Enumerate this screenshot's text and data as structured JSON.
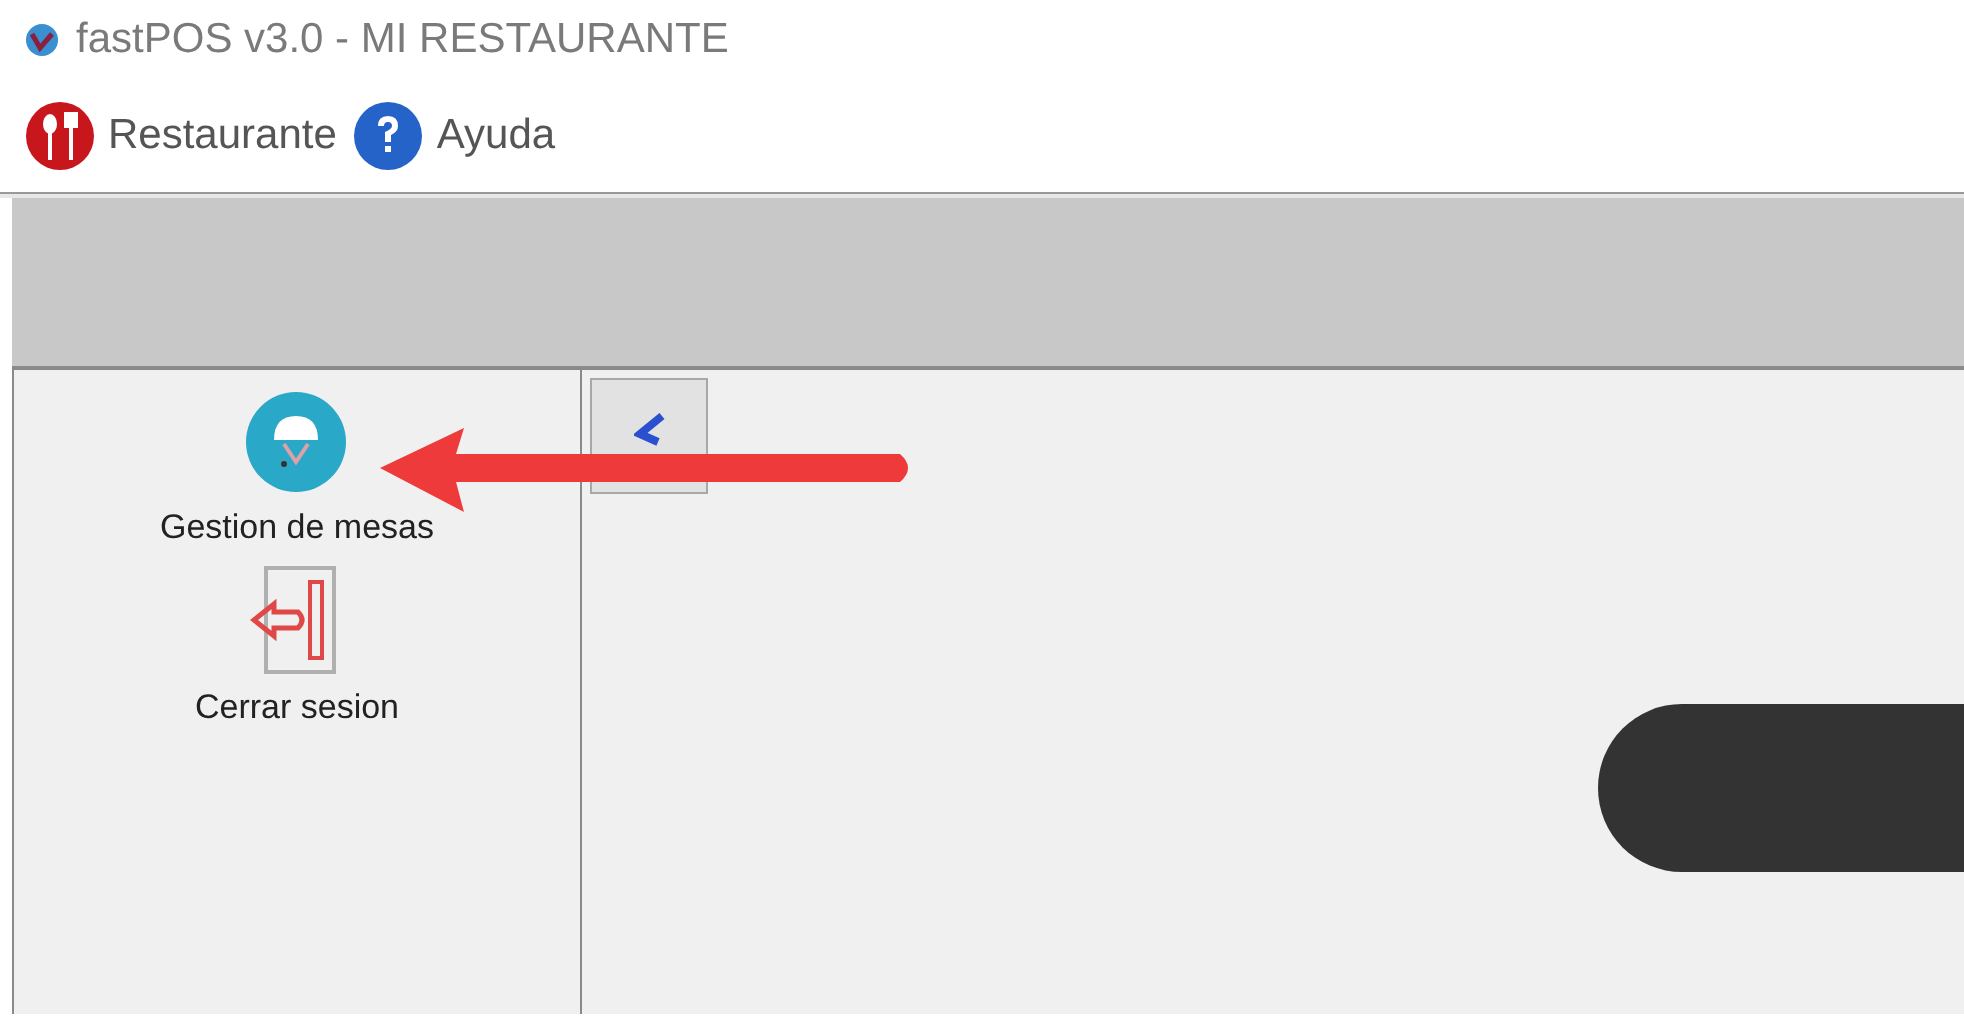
{
  "window": {
    "title": "fastPOS v3.0 - MI RESTAURANTE"
  },
  "menu": [
    {
      "label": "Restaurante",
      "kind": "restaurant"
    },
    {
      "label": "Ayuda",
      "kind": "help"
    }
  ],
  "sidebar": {
    "items": [
      {
        "label": "Gestion de mesas",
        "kind": "tables"
      },
      {
        "label": "Cerrar sesion",
        "kind": "logout"
      }
    ]
  }
}
